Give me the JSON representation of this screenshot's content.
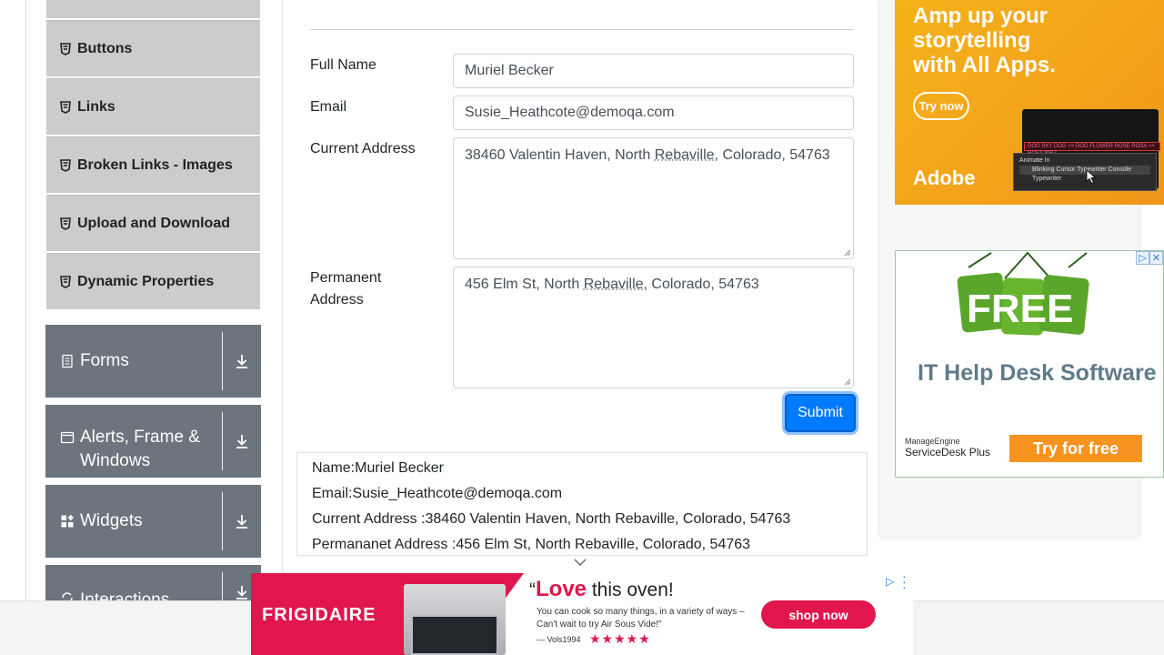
{
  "sidebar": {
    "elements_items": [
      {
        "label": "Buttons"
      },
      {
        "label": "Links"
      },
      {
        "label": "Broken Links - Images"
      },
      {
        "label": "Upload and Download"
      },
      {
        "label": "Dynamic Properties"
      }
    ],
    "groups": [
      {
        "label": "Forms"
      },
      {
        "label_line1": "Alerts, Frame &",
        "label_line2": "Windows"
      },
      {
        "label": "Widgets"
      },
      {
        "label": "Interactions"
      }
    ]
  },
  "form": {
    "full_name_label": "Full Name",
    "full_name_value": "Muriel Becker",
    "email_label": "Email",
    "email_value": "Susie_Heathcote@demoqa.com",
    "current_address_label": "Current Address",
    "current_address_value_a": "38460 Valentin Haven, North ",
    "current_address_value_b": "Rebaville",
    "current_address_value_c": ", Colorado, 54763",
    "permanent_address_label_line1": "Permanent",
    "permanent_address_label_line2": "Address",
    "permanent_address_value_a": "456 Elm St, North ",
    "permanent_address_value_b": "Rebaville",
    "permanent_address_value_c": ", Colorado, 54763",
    "submit_label": "Submit"
  },
  "output": {
    "name": "Name:Muriel Becker",
    "email": "Email:Susie_Heathcote@demoqa.com",
    "current_address": "Current Address :38460 Valentin Haven, North Rebaville, Colorado, 54763",
    "permanent_address": "Permananet Address :456 Elm St, North Rebaville, Colorado, 54763"
  },
  "ads": {
    "adobe": {
      "headline_line1": "Amp up your",
      "headline_line2": "storytelling",
      "headline_line3": "with All Apps.",
      "cta": "Try now",
      "brand": "Adobe",
      "ui_top": "DOG SKY DOG >> DOG FLOWER ROSE ROSA >> ROSA WRZ",
      "ui_line1": "Animate In",
      "ui_line2": "Blinking Cursor Typewriter Console",
      "ui_line3": "Typewriter"
    },
    "managengine": {
      "badge": "FREE",
      "title": "IT Help Desk Software",
      "brand_line1": "ManageEngine",
      "brand_line2": "ServiceDesk Plus",
      "cta": "Try for free"
    },
    "frigidaire": {
      "logo": "FRIGIDAIRE",
      "quote_em": "Love",
      "quote_rest": " this oven!",
      "body": "You can cook so many things, in a variety of ways – Can't wait to try Air Sous Vide!\"",
      "byline": "— Vols1994",
      "stars": "★★★★★",
      "cta": "shop now"
    }
  },
  "colors": {
    "accent_blue": "#007bff",
    "group_gray": "#6c757d",
    "menu_gray": "#cccccc",
    "frigidaire_red": "#e0164c"
  }
}
